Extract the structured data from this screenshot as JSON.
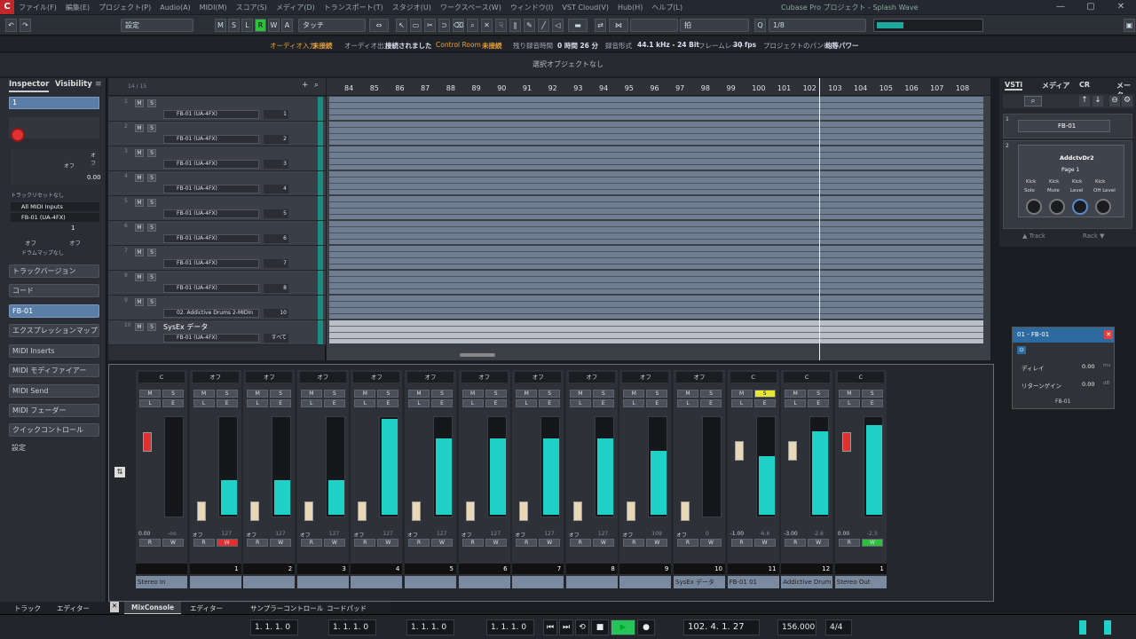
{
  "app": {
    "title": "Cubase Pro プロジェクト - Splash Wave",
    "menus": [
      "ファイル(F)",
      "編集(E)",
      "プロジェクト(P)",
      "Audio(A)",
      "MIDI(M)",
      "スコア(S)",
      "メディア(D)",
      "トランスポート(T)",
      "スタジオ(U)",
      "ワークスペース(W)",
      "ウィンドウ(I)",
      "VST Cloud(V)",
      "Hub(H)",
      "ヘルプ(L)"
    ]
  },
  "toolbar": {
    "setting": "設定",
    "mode_buttons": [
      "M",
      "S",
      "L",
      "R",
      "W",
      "A"
    ],
    "automation_mode": "タッチ",
    "snap_value": "拍",
    "quantize_value": "1/8"
  },
  "status": {
    "audio_in_label": "オーディオ入力",
    "audio_in_value": "未接続",
    "audio_out_label": "オーディオ出力",
    "audio_out_value": "接続されました",
    "control_room_label": "Control Room",
    "control_room_value": "未接続",
    "rec_time_label": "残り録音時間",
    "rec_time_value": "0 時間 26 分",
    "format_label": "録音形式",
    "format_value": "44.1 kHz - 24 Bit",
    "framerate_label": "フレームレート",
    "framerate_value": "30 fps",
    "pan_label": "プロジェクトのパン補正",
    "pan_value": "均等パワー"
  },
  "info_line": "選択オブジェクトなし",
  "inspector": {
    "tabs": [
      "Inspector",
      "Visibility"
    ],
    "track_field": "1",
    "vol_label": "オフ",
    "pan_label": "オフ",
    "vol_value": "0.00",
    "midi_reset": "トラックリセットなし",
    "input": "All MIDI Inputs",
    "output": "FB-01 (UA-4FX)",
    "channel": "1",
    "off1": "オフ",
    "off2": "オフ",
    "drummap": "ドラムマップなし",
    "sections": [
      "トラックバージョン",
      "コード",
      "FB-01",
      "エクスプレッションマップ",
      "MIDI Inserts",
      "MIDI モディファイアー",
      "MIDI Send",
      "MIDI フェーダー",
      "クイックコントロール",
      "設定"
    ]
  },
  "tracklist": {
    "counter": "14 / 15",
    "tracks": [
      {
        "n": "1",
        "name": "FB-01 (UA-4FX)",
        "ch": "1"
      },
      {
        "n": "2",
        "name": "FB-01 (UA-4FX)",
        "ch": "2"
      },
      {
        "n": "3",
        "name": "FB-01 (UA-4FX)",
        "ch": "3"
      },
      {
        "n": "4",
        "name": "FB-01 (UA-4FX)",
        "ch": "4"
      },
      {
        "n": "5",
        "name": "FB-01 (UA-4FX)",
        "ch": "5"
      },
      {
        "n": "6",
        "name": "FB-01 (UA-4FX)",
        "ch": "6"
      },
      {
        "n": "7",
        "name": "FB-01 (UA-4FX)",
        "ch": "7"
      },
      {
        "n": "8",
        "name": "FB-01 (UA-4FX)",
        "ch": "8"
      },
      {
        "n": "9",
        "name": "02. Addictive Drums 2-MIDIn",
        "ch": "10"
      },
      {
        "n": "10",
        "name": "FB-01 (UA-4FX)",
        "ch": "すべて",
        "title": "SysEx データ"
      }
    ]
  },
  "ruler": [
    "84",
    "85",
    "86",
    "87",
    "88",
    "89",
    "90",
    "91",
    "92",
    "93",
    "94",
    "95",
    "96",
    "97",
    "98",
    "99",
    "100",
    "101",
    "102",
    "103",
    "104",
    "105",
    "106",
    "107",
    "108"
  ],
  "vsti": {
    "tabs": [
      "VSTi",
      "メディア",
      "CR",
      "メーター"
    ],
    "slot1_num": "1",
    "slot1_name": "FB-01",
    "slot2_num": "2",
    "slot2_name": "AddctvDr2",
    "page": "Page 1",
    "qc_names": [
      "Kick",
      "Kick",
      "Kick",
      "Kick"
    ],
    "qc_params": [
      "Solo",
      "Mute",
      "Level",
      "OH Level"
    ],
    "track_label": "Track",
    "rack_label": "Rack"
  },
  "fx_window": {
    "title": "01 - FB-01",
    "delay_label": "ディレイ",
    "delay_value": "0.00",
    "delay_unit": "ms",
    "return_label": "リターンゲイン",
    "return_value": "0.00",
    "return_unit": "dB",
    "footer": "FB-01"
  },
  "mixer": {
    "strips": [
      {
        "pan": "C",
        "vol": "0.00",
        "peak": "-oo",
        "num": "",
        "name": "Stereo In",
        "level": 0
      },
      {
        "pan": "オフ",
        "vol": "オフ",
        "peak": "127",
        "num": "1",
        "name": "",
        "level": 0.35
      },
      {
        "pan": "オフ",
        "vol": "オフ",
        "peak": "127",
        "num": "2",
        "name": "",
        "level": 0.35
      },
      {
        "pan": "オフ",
        "vol": "オフ",
        "peak": "127",
        "num": "3",
        "name": "",
        "level": 0.35
      },
      {
        "pan": "オフ",
        "vol": "オフ",
        "peak": "127",
        "num": "4",
        "name": "",
        "level": 0.98
      },
      {
        "pan": "オフ",
        "vol": "オフ",
        "peak": "127",
        "num": "5",
        "name": "",
        "level": 0.78
      },
      {
        "pan": "オフ",
        "vol": "オフ",
        "peak": "127",
        "num": "6",
        "name": "",
        "level": 0.78
      },
      {
        "pan": "オフ",
        "vol": "オフ",
        "peak": "127",
        "num": "7",
        "name": "",
        "level": 0.78
      },
      {
        "pan": "オフ",
        "vol": "オフ",
        "peak": "127",
        "num": "8",
        "name": "",
        "level": 0.78
      },
      {
        "pan": "オフ",
        "vol": "オフ",
        "peak": "109",
        "num": "9",
        "name": "",
        "level": 0.65
      },
      {
        "pan": "オフ",
        "vol": "オフ",
        "peak": "0",
        "num": "10",
        "name": "SysEx データ",
        "level": 0
      },
      {
        "pan": "C",
        "vol": "-1.00",
        "peak": "-6.6",
        "num": "11",
        "name": "FB-01 01",
        "level": 0.6
      },
      {
        "pan": "C",
        "vol": "-3.00",
        "peak": "-2.6",
        "num": "12",
        "name": "Addictive Drum",
        "level": 0.85
      },
      {
        "pan": "C",
        "vol": "0.00",
        "peak": "-2.3",
        "num": "1",
        "name": "Stereo Out",
        "level": 0.92
      }
    ]
  },
  "bottom": {
    "left_tabs": [
      "トラック",
      "エディター"
    ],
    "tabs": [
      "MixConsole",
      "エディター",
      "サンプラーコントロール",
      "コードパッド"
    ]
  },
  "transport": {
    "left_locator": "1. 1. 1. 0",
    "right_locator": "1. 1. 1. 0",
    "punch": "1. 1. 1. 0",
    "position": "1. 1. 1. 0",
    "primary_time": "102. 4. 1. 27",
    "tempo": "156.000",
    "signature": "4/4"
  },
  "colors": {
    "accent": "#1fd0c6",
    "mute": "#e8e832",
    "record": "#e03030"
  }
}
